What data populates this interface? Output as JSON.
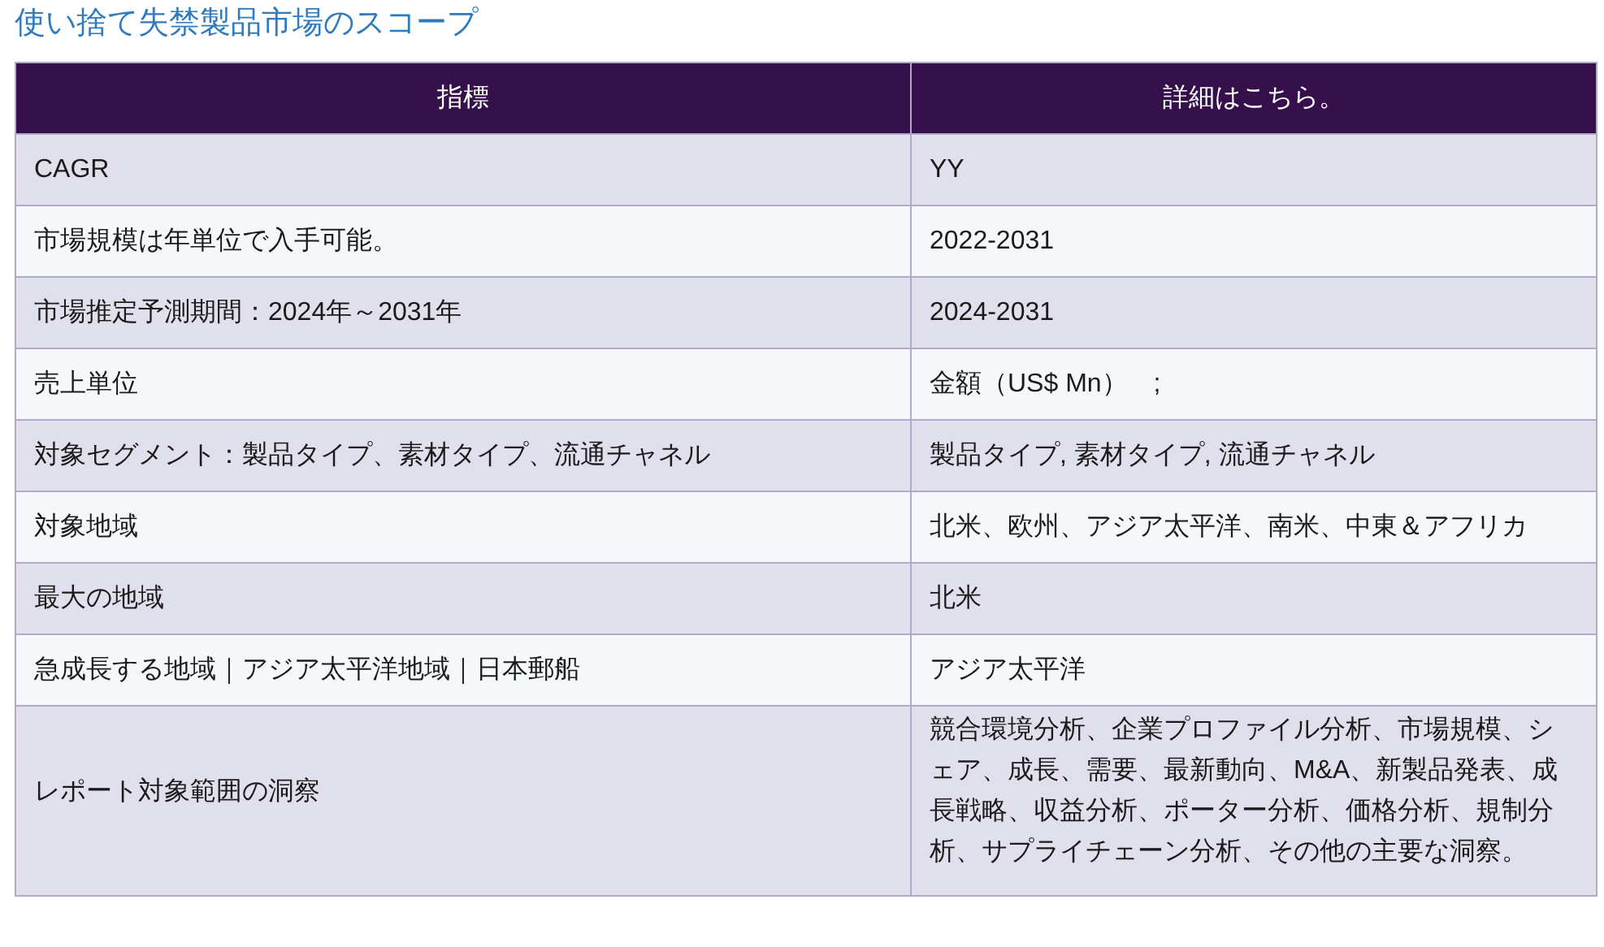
{
  "title": "使い捨て失禁製品市場のスコープ",
  "table": {
    "columns": [
      "指標",
      "詳細はこちら。"
    ],
    "rows": [
      [
        "CAGR",
        "YY"
      ],
      [
        "市場規模は年単位で入手可能。",
        "2022-2031"
      ],
      [
        "市場推定予測期間：2024年～2031年",
        "2024-2031"
      ],
      [
        "売上単位",
        "金額（US$ Mn）　;"
      ],
      [
        "対象セグメント：製品タイプ、素材タイプ、流通チャネル",
        "製品タイプ, 素材タイプ, 流通チャネル"
      ],
      [
        "対象地域",
        "北米、欧州、アジア太平洋、南米、中東＆アフリカ"
      ],
      [
        "最大の地域",
        "北米"
      ],
      [
        "急成長する地域｜アジア太平洋地域｜日本郵船",
        "アジア太平洋"
      ],
      [
        "レポート対象範囲の洞察",
        "競合環境分析、企業プロファイル分析、市場規模、シェア、成長、需要、最新動向、M&A、新製品発表、成長戦略、収益分析、ポーター分析、価格分析、規制分析、サプライチェーン分析、その他の主要な洞察。"
      ]
    ]
  }
}
